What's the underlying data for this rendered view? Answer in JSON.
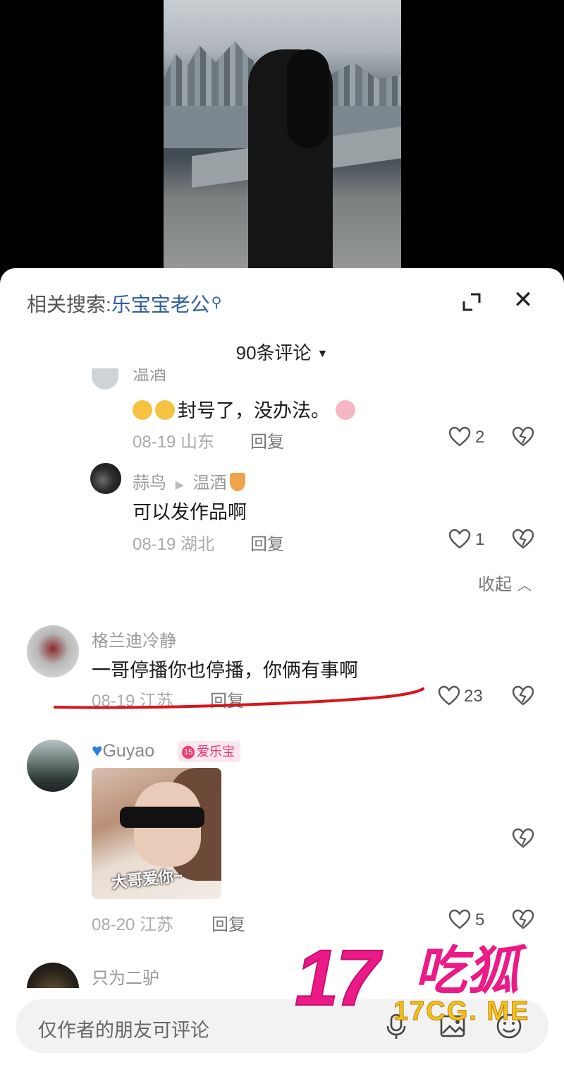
{
  "sheet": {
    "related_prefix": "相关搜索:",
    "related_keyword": "乐宝宝老公",
    "comment_count_label": "90条评论"
  },
  "comments": [
    {
      "name": "温酒",
      "text": "封号了，没办法。",
      "date": "08-19 山东",
      "reply": "回复",
      "likes": "2"
    },
    {
      "name": "蒜鸟",
      "reply_to": "温酒",
      "text": "可以发作品啊",
      "date": "08-19 湖北",
      "reply": "回复",
      "likes": "1"
    },
    {
      "collapse_label": "收起"
    },
    {
      "name": "格兰迪冷静",
      "text": "一哥停播你也停播，你俩有事啊",
      "date": "08-19 江苏",
      "reply": "回复",
      "likes": "23"
    },
    {
      "name": "Guyao",
      "badge_level": "15",
      "badge_text": "爱乐宝",
      "sticker_caption": "大哥爱你~",
      "date": "08-20 江苏",
      "reply": "回复",
      "likes": "5"
    },
    {
      "name": "只为二驴"
    }
  ],
  "input": {
    "placeholder": "仅作者的朋友可评论"
  },
  "watermark": {
    "number": "17",
    "chinese": "吃狐",
    "url": "17CG. ME"
  },
  "colors": {
    "accent_link": "#2f5f9f",
    "watermark_pink": "#ec1a86",
    "watermark_yellow": "#f6c21a",
    "annotation_red": "#d7141a"
  }
}
